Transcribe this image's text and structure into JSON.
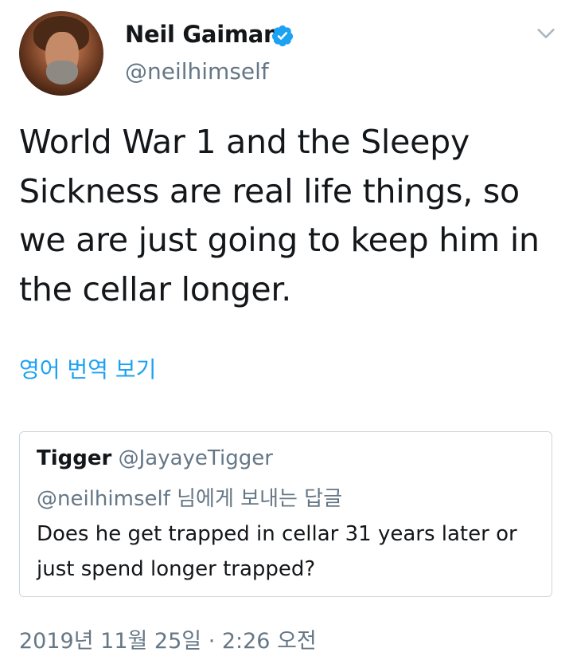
{
  "author": {
    "name": "Neil Gaiman",
    "handle": "@neilhimself",
    "verified": true,
    "avatar_icon": "profile-photo"
  },
  "tweet": {
    "text": "World War 1 and the Sleepy Sickness are real life things, so we are just going to keep him in the cellar longer.",
    "translate_link": "영어 번역 보기",
    "timestamp": "2019년 11월 25일 · 2:26 오전"
  },
  "quoted_tweet": {
    "name": "Tigger",
    "handle": "@JayayeTigger",
    "reply_to": "@neilhimself 님에게 보내는 답글",
    "text": "Does he get trapped in cellar 31 years later or just spend longer trapped?"
  },
  "colors": {
    "link_blue": "#1da1f2",
    "secondary_gray": "#657786",
    "border_gray": "#ccd6dd",
    "text_dark": "#14171a"
  },
  "icons": {
    "verified": "verified-badge-icon",
    "menu": "chevron-down-icon"
  }
}
